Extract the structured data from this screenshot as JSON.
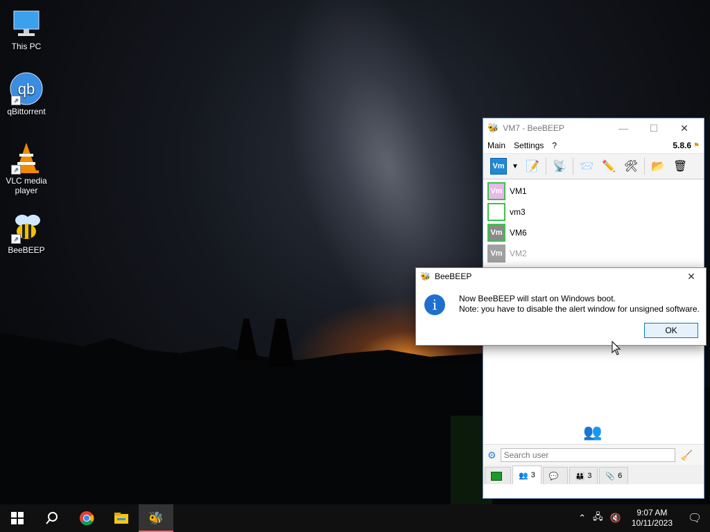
{
  "desktop": {
    "icons": [
      {
        "label": "This PC"
      },
      {
        "label": "qBittorrent"
      },
      {
        "label": "VLC media player"
      },
      {
        "label": "BeeBEEP"
      }
    ]
  },
  "main_window": {
    "title": "VM7 - BeeBEEP",
    "controls": {
      "minimize": "—",
      "maximize": "☐",
      "close": "✕"
    },
    "menu": {
      "main": "Main",
      "settings": "Settings",
      "help": "?"
    },
    "version": "5.8.6",
    "toolbar": {
      "status_avatar": "Vm"
    },
    "users": [
      {
        "name": "VM1",
        "avatar": "Vm",
        "color": "#e8b8e8"
      },
      {
        "name": "vm3",
        "avatar": "",
        "color": "#ffffff"
      },
      {
        "name": "VM6",
        "avatar": "Vm",
        "color": "#8a8a8a"
      },
      {
        "name": "VM2",
        "avatar": "Vm",
        "color": "#a0a0a0"
      }
    ],
    "search": {
      "placeholder": "Search user"
    },
    "tabs": [
      {
        "count": ""
      },
      {
        "count": "3"
      },
      {
        "count": ""
      },
      {
        "count": "3"
      },
      {
        "count": "6"
      }
    ]
  },
  "dialog": {
    "title": "BeeBEEP",
    "line1": "Now BeeBEEP will start on Windows boot.",
    "line2": "Note: you have to disable the alert window for unsigned software.",
    "ok_label": "OK",
    "icon": "info-icon"
  },
  "taskbar": {
    "time": "9:07 AM",
    "date": "10/11/2023"
  },
  "colors": {
    "accent": "#0078d7",
    "online": "#3cc24c",
    "taskbar": "#101010"
  }
}
